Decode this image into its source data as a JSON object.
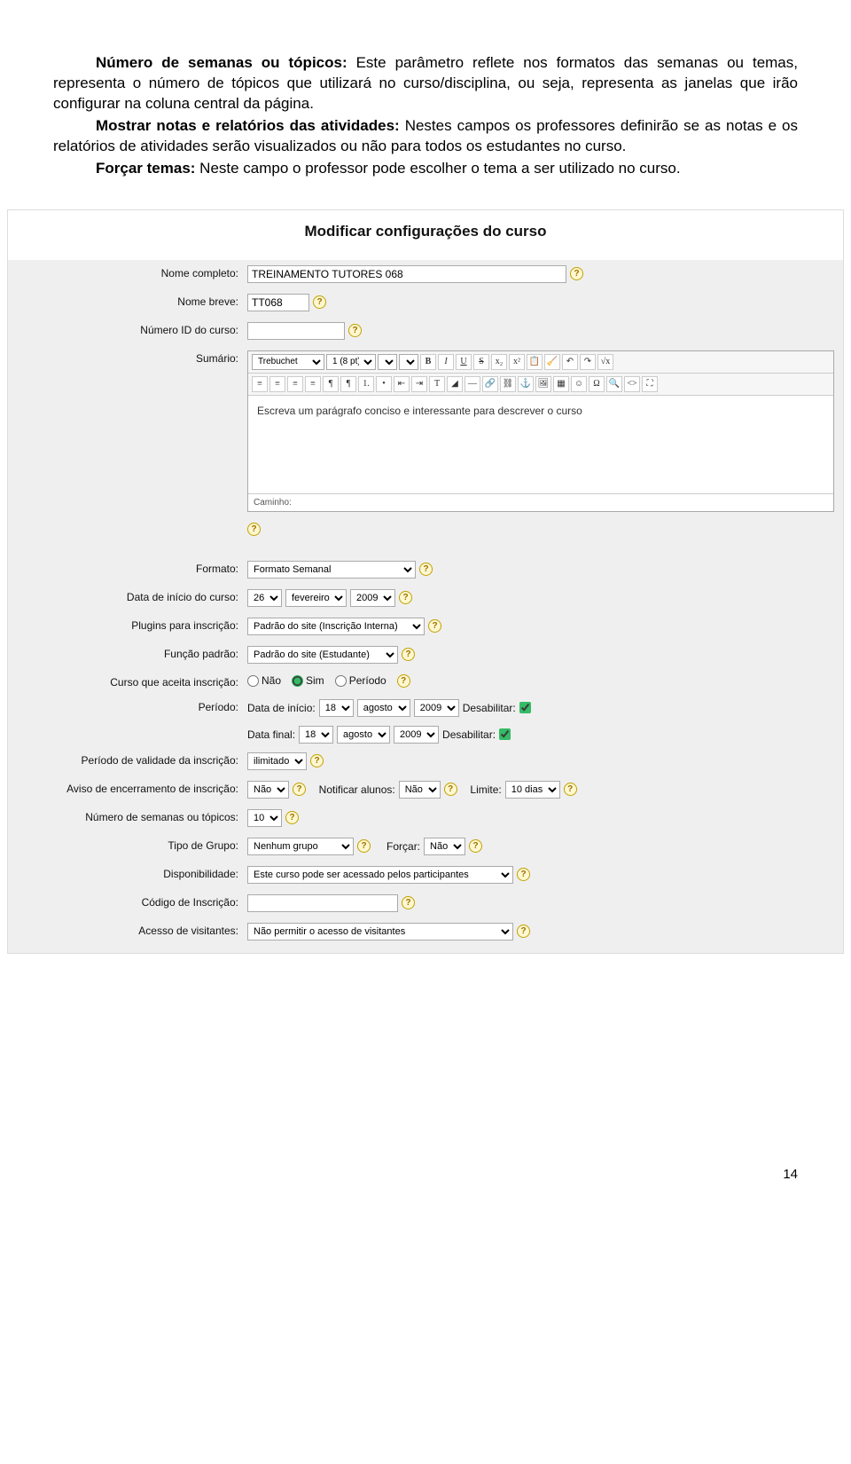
{
  "doc": {
    "p1_bold": "Número de semanas ou tópicos: ",
    "p1_rest": "Este parâmetro reflete nos formatos das semanas ou temas, representa o número de tópicos que utilizará no curso/disciplina, ou seja, representa as janelas que irão configurar na coluna central da página.",
    "p2_bold": "Mostrar notas e relatórios das atividades: ",
    "p2_rest": "Nestes campos os professores definirão se as notas e os relatórios de atividades serão visualizados ou não para todos os estudantes no curso.",
    "p3_bold": "Forçar temas: ",
    "p3_rest": "Neste campo o professor pode escolher o tema a ser utilizado no curso."
  },
  "form": {
    "panel_title": "Modificar configurações do curso",
    "labels": {
      "nome_completo": "Nome completo:",
      "nome_breve": "Nome breve:",
      "numero_id": "Número ID do curso:",
      "sumario": "Sumário:",
      "formato": "Formato:",
      "data_inicio": "Data de início do curso:",
      "plugins": "Plugins para inscrição:",
      "funcao": "Função padrão:",
      "aceita_inscricao": "Curso que aceita inscrição:",
      "periodo": "Período:",
      "validade": "Período de validade da inscrição:",
      "aviso_enc": "Aviso de encerramento de inscrição:",
      "num_semanas": "Número de semanas ou tópicos:",
      "tipo_grupo": "Tipo de Grupo:",
      "disponibilidade": "Disponibilidade:",
      "codigo_insc": "Código de Inscrição:",
      "acesso_vis": "Acesso de visitantes:"
    },
    "values": {
      "nome_completo": "TREINAMENTO TUTORES 068",
      "nome_breve": "TT068",
      "numero_id": "",
      "editor_placeholder": "Escreva um parágrafo conciso e interessante para descrever o curso",
      "editor_path": "Caminho:",
      "formato": "Formato Semanal",
      "d_dia": "26",
      "d_mes": "fevereiro",
      "d_ano": "2009",
      "plugins": "Padrão do site (Inscrição Interna)",
      "funcao": "Padrão do site (Estudante)",
      "radio_nao": "Não",
      "radio_sim": "Sim",
      "radio_periodo": "Período",
      "periodo_data_inicio": "Data de início:",
      "periodo_data_final": "Data final:",
      "p_dia": "18",
      "p_mes": "agosto",
      "p_ano": "2009",
      "desabilitar": "Desabilitar:",
      "validade": "ilimitado",
      "aviso_enc": "Não",
      "notificar_alunos_lbl": "Notificar alunos:",
      "notificar_alunos": "Não",
      "limite_lbl": "Limite:",
      "limite": "10 dias",
      "num_semanas": "10",
      "tipo_grupo": "Nenhum grupo",
      "forcar_lbl": "Forçar:",
      "forcar": "Não",
      "disponibilidade": "Este curso pode ser acessado pelos participantes",
      "codigo_insc": "",
      "acesso_vis": "Não permitir o acesso de visitantes"
    },
    "toolbar": {
      "font": "Trebuchet",
      "size": "1 (8 pt)"
    }
  },
  "page_num": "14"
}
